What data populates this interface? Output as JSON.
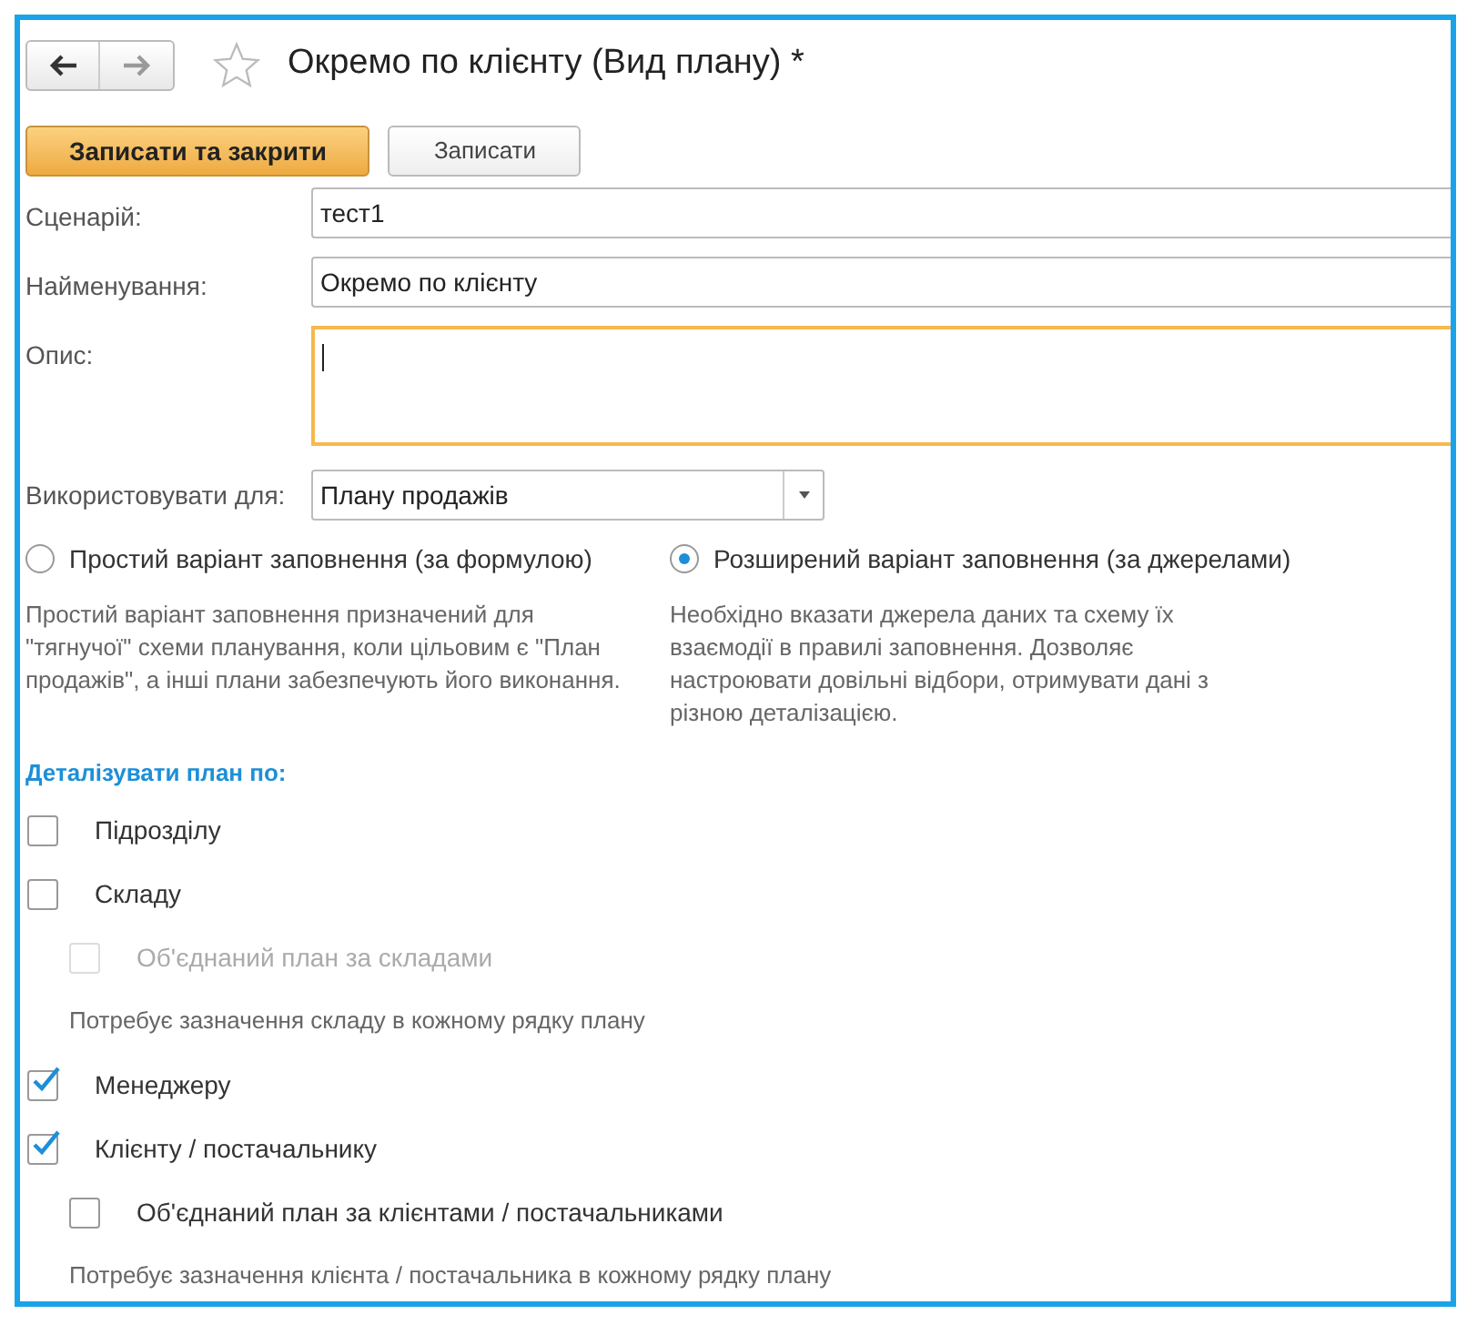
{
  "title": "Окремо по клієнту (Вид плану) *",
  "buttons": [
    {
      "label": "Записати та закрити",
      "kind": "primary"
    },
    {
      "label": "Записати",
      "kind": "secondary"
    }
  ],
  "fields": [
    {
      "label": "Сценарій:",
      "kind": "text",
      "value": "тест1"
    },
    {
      "label": "Найменування:",
      "kind": "text",
      "value": "Окремо по клієнту"
    },
    {
      "label": "Опис:",
      "kind": "textarea",
      "focused": true
    },
    {
      "label": "Використовувати для:",
      "kind": "select",
      "value": "Плану продажів"
    }
  ],
  "fill_options": [
    {
      "label": "Простий варіант заповнення (за формулою)",
      "selected": false,
      "description": "Простий варіант заповнення призначений для \"тягнучої\" схеми планування, коли цільовим є \"План продажів\", а інші плани забезпечують його виконання."
    },
    {
      "label": "Розширений варіант заповнення (за джерелами)",
      "selected": true,
      "description": "Необхідно вказати джерела даних та схему їх взаємодії в правилі заповнення. Дозволяє настроювати довільні відбори, отримувати дані з різною деталізацією."
    }
  ],
  "detail": {
    "title": "Деталізувати план по:",
    "items": [
      {
        "kind": "checkbox",
        "label": "Підрозділу",
        "checked": false,
        "disabled": false
      },
      {
        "kind": "checkbox",
        "label": "Складу",
        "checked": false,
        "disabled": false,
        "children": [
          {
            "kind": "checkbox",
            "label": "Об'єднаний план за складами",
            "checked": false,
            "disabled": true
          },
          {
            "kind": "note",
            "text": "Потребує зазначення складу в кожному рядку плану"
          }
        ]
      },
      {
        "kind": "checkbox",
        "label": "Менеджеру",
        "checked": true,
        "disabled": false
      },
      {
        "kind": "checkbox",
        "label": "Клієнту / постачальнику",
        "checked": true,
        "disabled": false,
        "children": [
          {
            "kind": "checkbox",
            "label": "Об'єднаний план за клієнтами / постачальниками",
            "checked": false,
            "disabled": false
          },
          {
            "kind": "note",
            "text": "Потребує зазначення клієнта / постачальника в кожному рядку плану"
          }
        ]
      }
    ]
  }
}
